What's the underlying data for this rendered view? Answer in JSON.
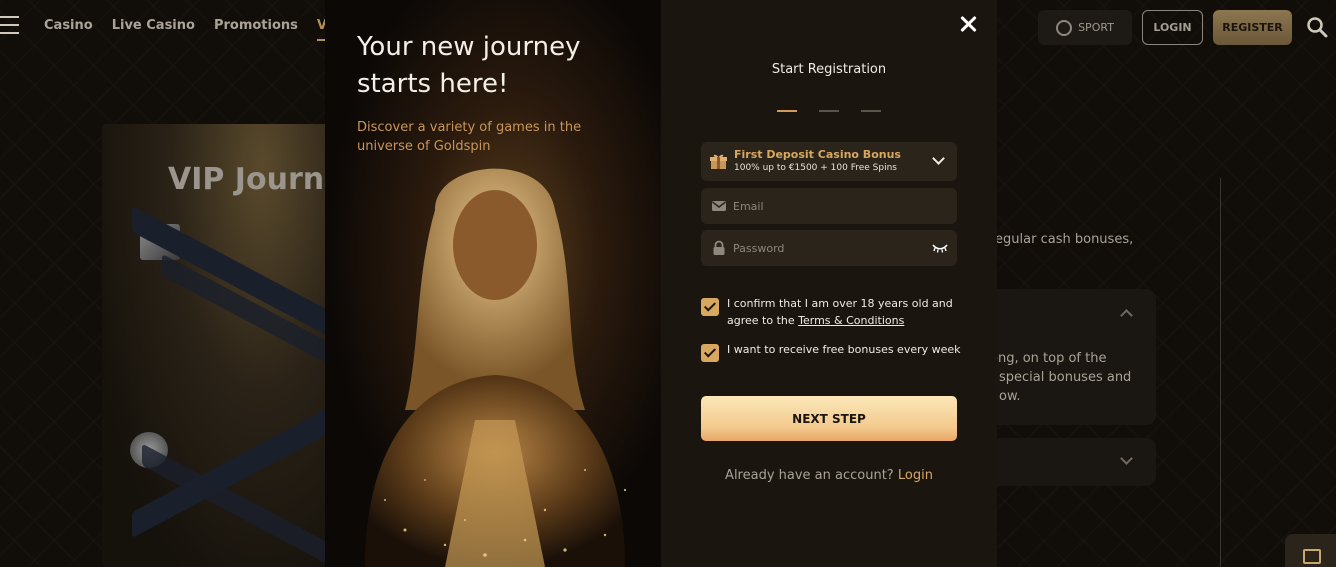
{
  "nav": {
    "items": [
      "Casino",
      "Live Casino",
      "Promotions",
      "VIP"
    ],
    "active": "VIP"
  },
  "header": {
    "sport_label": "SPORT",
    "login_label": "LOGIN",
    "register_label": "REGISTER"
  },
  "background": {
    "vip_title": "VIP Journe",
    "text_1": "regular cash bonuses,",
    "text_2a": "ong, on top of the",
    "text_2b": "special bonuses and",
    "text_2c": "ow."
  },
  "hero": {
    "headline": "Your new journey starts here!",
    "subtitle": "Discover a variety of games in the universe of Goldspin"
  },
  "registration": {
    "title": "Start Registration",
    "steps": 3,
    "current_step": 1,
    "bonus_title": "First Deposit Casino Bonus",
    "bonus_sub": "100% up to €1500 + 100 Free Spins",
    "email_placeholder": "Email",
    "password_placeholder": "Password",
    "age_text": "I confirm that I am over 18 years old and agree to the",
    "terms_link": "Terms & Conditions",
    "bonus_opt_text": "I want to receive free bonuses every week",
    "next_label": "NEXT STEP",
    "account_text": "Already have an account?",
    "account_link": "Login"
  },
  "colors": {
    "accent": "#d8a760",
    "background": "#1b1510",
    "field": "#2a241b"
  }
}
